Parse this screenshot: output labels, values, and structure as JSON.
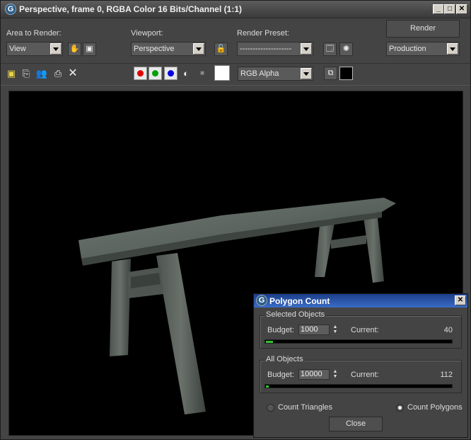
{
  "window": {
    "title": "Perspective, frame 0, RGBA Color 16 Bits/Channel (1:1)",
    "app_icon_glyph": "G",
    "controls": [
      "_",
      "□",
      "✕"
    ]
  },
  "toolbar": {
    "area_to_render_label": "Area to Render:",
    "area_to_render_value": "View",
    "viewport_label": "Viewport:",
    "viewport_value": "Perspective",
    "render_preset_label": "Render Preset:",
    "render_preset_value": "--------------------",
    "render_button": "Render",
    "render_mode_value": "Production",
    "channel_value": "RGB Alpha",
    "icons": {
      "pan": "hand-icon",
      "region": "region-icon",
      "lock": "lock-icon",
      "preset_settings": "render-setup-icon",
      "environment": "environment-icon",
      "save": "save-icon",
      "copy": "copy-icon",
      "clone": "clone-window-icon",
      "print": "print-icon",
      "clear": "clear-icon",
      "mono": "monochrome-icon",
      "swatch": "color-swatch-icon",
      "toggle_ui": "toggle-ui-overlay-icon",
      "toggle_display": "display-toggle-icon"
    },
    "channels": [
      {
        "name": "red-channel",
        "color": "#e00000"
      },
      {
        "name": "green-channel",
        "color": "#00a000"
      },
      {
        "name": "blue-channel",
        "color": "#0000e0"
      }
    ]
  },
  "polygon_dialog": {
    "title": "Polygon Count",
    "close_glyph": "✕",
    "selected": {
      "caption": "Selected Objects",
      "budget_label": "Budget:",
      "budget_value": "1000",
      "current_label": "Current:",
      "current_value": "40",
      "fill_ratio": 0.04
    },
    "all": {
      "caption": "All Objects",
      "budget_label": "Budget:",
      "budget_value": "10000",
      "current_label": "Current:",
      "current_value": "112",
      "fill_ratio": 0.011
    },
    "count_triangles": "Count Triangles",
    "count_polygons": "Count Polygons",
    "selected_mode": "polygons",
    "close_button": "Close"
  },
  "colors": {
    "accent_title": "#1c3f8c",
    "progress": "#2ec52e"
  }
}
